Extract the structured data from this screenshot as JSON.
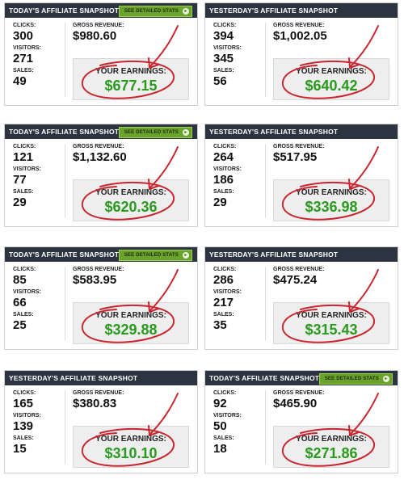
{
  "theme": {
    "header_bg": "#2d3441",
    "earnings_green": "#2a9a1e",
    "circle_red": "#c8262f",
    "button_green": "#6aa329"
  },
  "labels": {
    "clicks": "CLICKS:",
    "visitors": "VISITORS:",
    "sales": "SALES:",
    "gross": "GROSS REVENUE:",
    "earnings": "YOUR EARNINGS:"
  },
  "panels": [
    {
      "title": "TODAY'S AFFILIATE SNAPSHOT",
      "button": "SEE DETAILED STATS",
      "clicks": "300",
      "visitors": "271",
      "sales": "49",
      "gross": "$980.60",
      "earnings": "$677.15"
    },
    {
      "title": "YESTERDAY'S AFFILIATE SNAPSHOT",
      "button": "",
      "clicks": "394",
      "visitors": "345",
      "sales": "56",
      "gross": "$1,002.05",
      "earnings": "$640.42"
    },
    {
      "title": "TODAY'S AFFILIATE SNAPSHOT",
      "button": "SEE DETAILED STATS",
      "clicks": "121",
      "visitors": "77",
      "sales": "29",
      "gross": "$1,132.60",
      "earnings": "$620.36"
    },
    {
      "title": "YESTERDAY'S AFFILIATE SNAPSHOT",
      "button": "",
      "clicks": "264",
      "visitors": "186",
      "sales": "29",
      "gross": "$517.95",
      "earnings": "$336.98"
    },
    {
      "title": "TODAY'S AFFILIATE SNAPSHOT",
      "button": "SEE DETAILED STATS",
      "clicks": "85",
      "visitors": "66",
      "sales": "25",
      "gross": "$583.95",
      "earnings": "$329.88"
    },
    {
      "title": "YESTERDAY'S AFFILIATE SNAPSHOT",
      "button": "",
      "clicks": "286",
      "visitors": "217",
      "sales": "35",
      "gross": "$475.24",
      "earnings": "$315.43"
    },
    {
      "title": "YESTERDAY'S AFFILIATE SNAPSHOT",
      "button": "",
      "clicks": "165",
      "visitors": "139",
      "sales": "15",
      "gross": "$380.83",
      "earnings": "$310.10"
    },
    {
      "title": "TODAY'S AFFILIATE SNAPSHOT",
      "button": "SEE DETAILED STATS",
      "clicks": "92",
      "visitors": "50",
      "sales": "18",
      "gross": "$465.90",
      "earnings": "$271.86"
    }
  ]
}
